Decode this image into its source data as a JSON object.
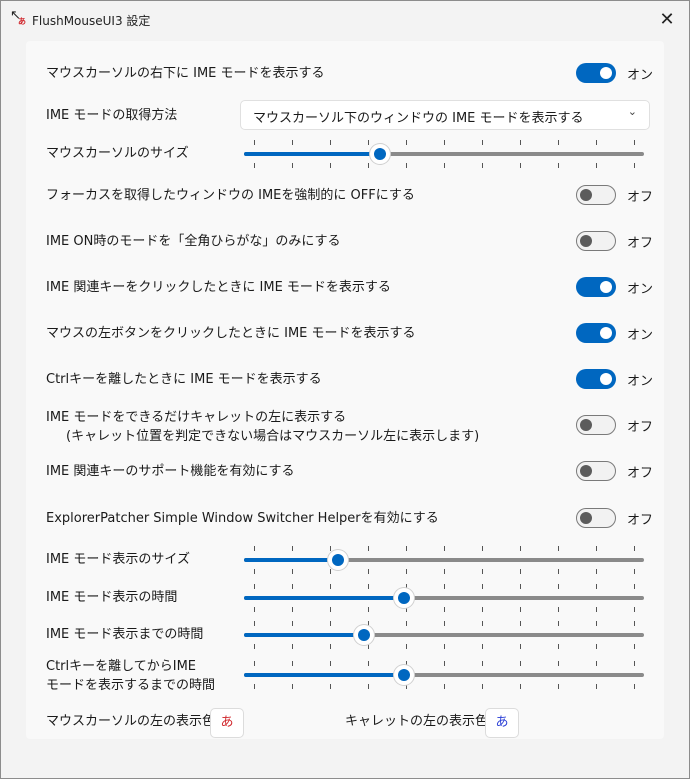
{
  "window": {
    "title": "FlushMouseUI3 設定",
    "app_icon_kana": "あ"
  },
  "settings": {
    "show_ime_at_cursor": {
      "label": "マウスカーソルの右下に IME モードを表示する",
      "state": "オン",
      "on": true
    },
    "ime_mode_method": {
      "label": "IME モードの取得方法",
      "value": "マウスカーソル下のウィンドウの IME モードを表示する"
    },
    "cursor_size": {
      "label": "マウスカーソルのサイズ",
      "level": 0.34
    },
    "force_ime_off": {
      "label": "フォーカスを取得したウィンドウの IMEを強制的に OFFにする",
      "state": "オフ",
      "on": false
    },
    "ime_on_hiragana": {
      "label": "IME ON時のモードを「全角ひらがな」のみにする",
      "state": "オフ",
      "on": false
    },
    "show_on_ime_key": {
      "label": "IME 関連キーをクリックしたときに IME モードを表示する",
      "state": "オン",
      "on": true
    },
    "show_on_left_click": {
      "label": "マウスの左ボタンをクリックしたときに IME モードを表示する",
      "state": "オン",
      "on": true
    },
    "show_on_ctrl_release": {
      "label": "Ctrlキーを離したときに IME モードを表示する",
      "state": "オン",
      "on": true
    },
    "show_left_of_caret": {
      "label": "IME モードをできるだけキャレットの左に表示する",
      "sublabel": "(キャレット位置を判定できない場合はマウスカーソル左に表示します)",
      "state": "オフ",
      "on": false
    },
    "ime_key_support": {
      "label": "IME 関連キーのサポート機能を有効にする",
      "state": "オフ",
      "on": false
    },
    "explorer_patcher": {
      "label": "ExplorerPatcher Simple Window Switcher Helperを有効にする",
      "state": "オフ",
      "on": false
    },
    "ime_display_size": {
      "label": "IME モード表示のサイズ",
      "level": 0.235
    },
    "ime_display_time": {
      "label": "IME モード表示の時間",
      "level": 0.4
    },
    "ime_display_delay": {
      "label": "IME モード表示までの時間",
      "level": 0.3
    },
    "ctrl_release_delay": {
      "label_line1": "Ctrlキーを離してからIME",
      "label_line2": "モードを表示するまでの時間",
      "level": 0.4
    },
    "cursor_left_color": {
      "label": "マウスカーソルの左の表示色",
      "button_text": "あ",
      "color": "#d0262c"
    },
    "caret_left_color": {
      "label": "キャレットの左の表示色",
      "button_text": "あ",
      "color": "#2b3fd6"
    }
  },
  "colors": {
    "accent": "#0067c0"
  }
}
